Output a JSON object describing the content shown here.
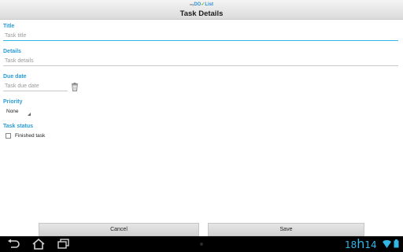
{
  "header": {
    "logo_prefix": "my",
    "logo_do": "DO",
    "logo_check": "✓",
    "logo_list": "List",
    "title": "Task Details"
  },
  "form": {
    "title_label": "Title",
    "title_placeholder": "Task title",
    "details_label": "Details",
    "details_placeholder": "Task details",
    "due_label": "Due date",
    "due_placeholder": "Task due date",
    "priority_label": "Priority",
    "priority_value": "None",
    "status_label": "Task status",
    "finished_label": "Finished task",
    "finished_checked": false
  },
  "buttons": {
    "cancel": "Cancel",
    "save": "Save"
  },
  "system_bar": {
    "clock_hour_tens": "18",
    "clock_h": "h",
    "clock_minutes": "14"
  },
  "colors": {
    "accent": "#33b5e5",
    "label": "#2a9bd6"
  },
  "icons": {
    "trash": "trash-icon",
    "back": "back-icon",
    "home": "home-icon",
    "recents": "recent-apps-icon",
    "wifi": "wifi-icon",
    "battery": "battery-icon"
  }
}
